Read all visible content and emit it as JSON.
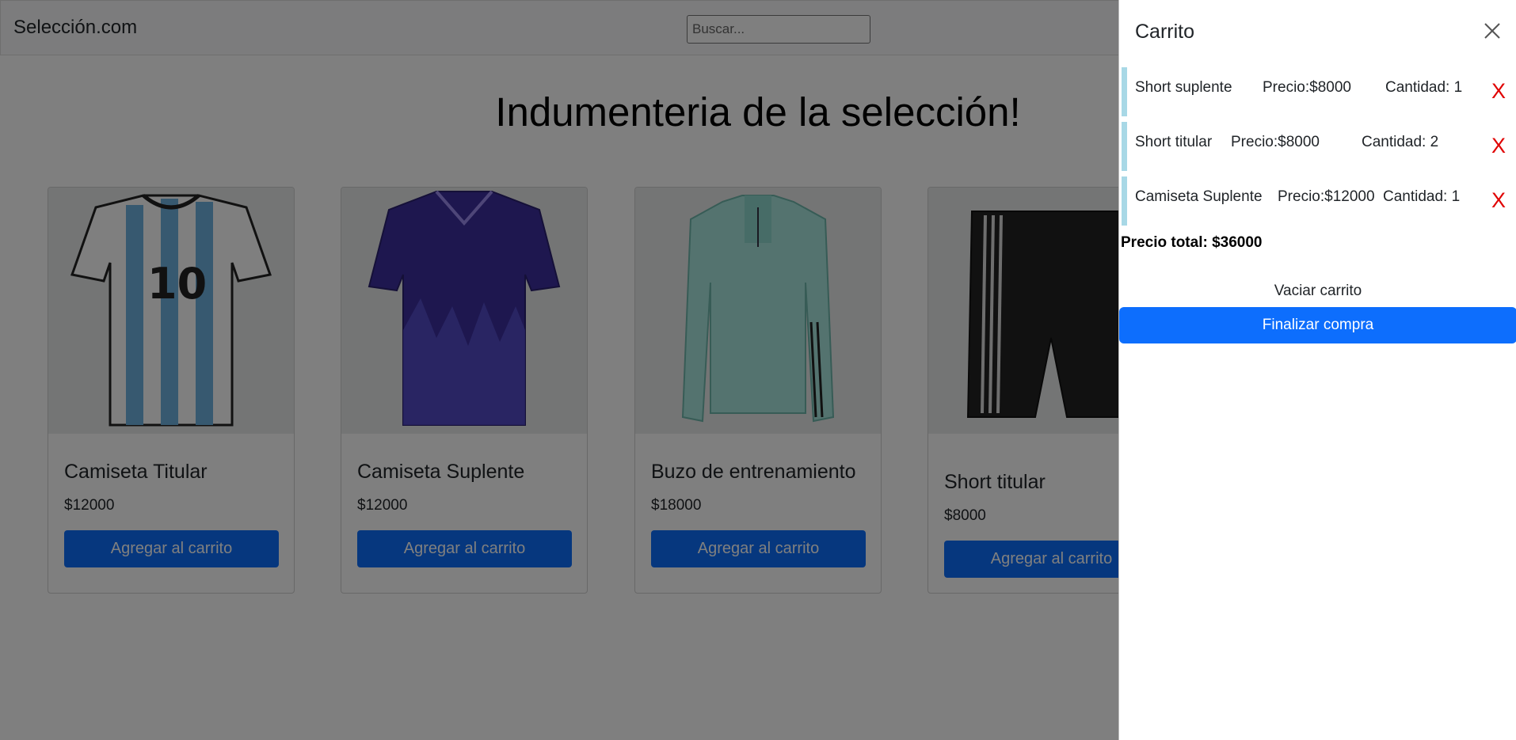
{
  "navbar": {
    "brand": "Selección.com",
    "search_placeholder": "Buscar..."
  },
  "main": {
    "title": "Indumenteria de la selección!"
  },
  "products": [
    {
      "name": "Camiseta Titular",
      "price": "$12000",
      "button": "Agregar al carrito"
    },
    {
      "name": "Camiseta Suplente",
      "price": "$12000",
      "button": "Agregar al carrito"
    },
    {
      "name": "Buzo de entrenamiento",
      "price": "$18000",
      "button": "Agregar al carrito"
    },
    {
      "name": "Short titular",
      "price": "$8000",
      "button": "Agregar al carrito"
    }
  ],
  "cart": {
    "title": "Carrito",
    "items": [
      {
        "name": "Short suplente",
        "price": "Precio:$8000",
        "qty": "Cantidad: 1",
        "remove": "X"
      },
      {
        "name": "Short titular",
        "price": "Precio:$8000",
        "qty": "Cantidad: 2",
        "remove": "X"
      },
      {
        "name": "Camiseta Suplente",
        "price": "Precio:$12000",
        "qty": "Cantidad: 1",
        "remove": "X"
      }
    ],
    "total": "Precio total: $36000",
    "empty_label": "Vaciar carrito",
    "checkout_label": "Finalizar compra"
  },
  "colors": {
    "primary": "#0d6efd",
    "remove": "#e00000",
    "item_accent": "#a8d8e6"
  }
}
